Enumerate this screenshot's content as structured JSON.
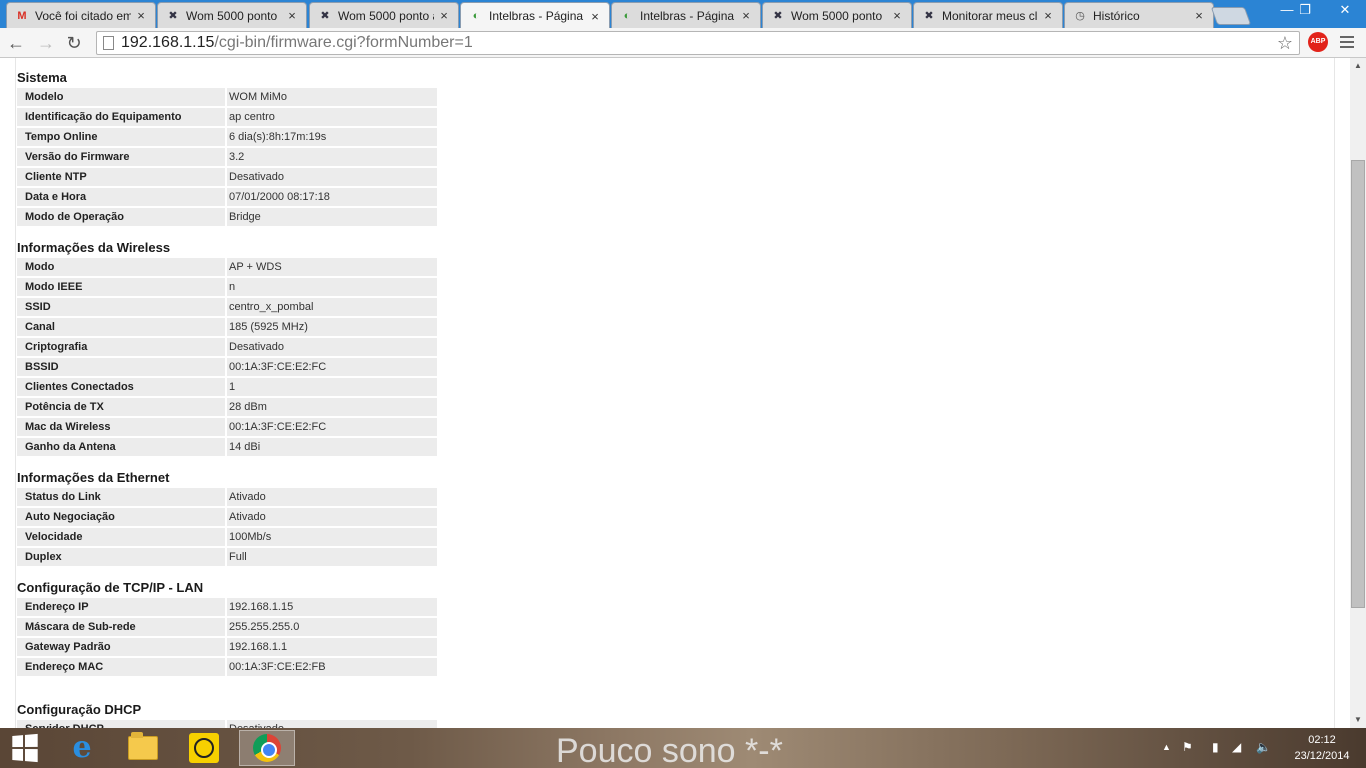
{
  "tabs": [
    {
      "title": "Você foi citado em",
      "icon": "gmail-icon",
      "active": false
    },
    {
      "title": "Wom 5000 ponto",
      "icon": "x-icon",
      "active": false
    },
    {
      "title": "Wom 5000 ponto a",
      "icon": "x-icon",
      "active": false
    },
    {
      "title": "Intelbras - Página",
      "icon": "intelbras-icon",
      "active": true
    },
    {
      "title": "Intelbras - Página",
      "icon": "intelbras-icon",
      "active": false
    },
    {
      "title": "Wom 5000 ponto",
      "icon": "x-icon",
      "active": false
    },
    {
      "title": "Monitorar meus cl",
      "icon": "x-icon",
      "active": false
    },
    {
      "title": "Histórico",
      "icon": "history-icon",
      "active": false
    }
  ],
  "toolbar": {
    "url_host": "192.168.1.15",
    "url_path": "/cgi-bin/firmware.cgi?formNumber=1",
    "abp_label": "ABP"
  },
  "sections": [
    {
      "heading": "Sistema",
      "rows": [
        {
          "label": "Modelo",
          "value": "WOM MiMo"
        },
        {
          "label": "Identificação do Equipamento",
          "value": "ap centro"
        },
        {
          "label": "Tempo Online",
          "value": "6 dia(s):8h:17m:19s"
        },
        {
          "label": "Versão do Firmware",
          "value": "3.2"
        },
        {
          "label": "Cliente NTP",
          "value": "Desativado"
        },
        {
          "label": "Data e Hora",
          "value": "07/01/2000 08:17:18"
        },
        {
          "label": "Modo de Operação",
          "value": "Bridge"
        }
      ]
    },
    {
      "heading": "Informações da Wireless",
      "rows": [
        {
          "label": "Modo",
          "value": "AP + WDS"
        },
        {
          "label": "Modo IEEE",
          "value": "n"
        },
        {
          "label": "SSID",
          "value": "centro_x_pombal"
        },
        {
          "label": "Canal",
          "value": "185 (5925 MHz)"
        },
        {
          "label": "Criptografia",
          "value": "Desativado"
        },
        {
          "label": "BSSID",
          "value": "00:1A:3F:CE:E2:FC"
        },
        {
          "label": "Clientes Conectados",
          "value": "1"
        },
        {
          "label": "Potência de TX",
          "value": "28 dBm"
        },
        {
          "label": "Mac da Wireless",
          "value": "00:1A:3F:CE:E2:FC"
        },
        {
          "label": "Ganho da Antena",
          "value": "14 dBi"
        }
      ]
    },
    {
      "heading": "Informações da Ethernet",
      "rows": [
        {
          "label": "Status do Link",
          "value": "Ativado"
        },
        {
          "label": "Auto Negociação",
          "value": "Ativado"
        },
        {
          "label": "Velocidade",
          "value": "100Mb/s"
        },
        {
          "label": "Duplex",
          "value": "Full"
        }
      ]
    },
    {
      "heading": "Configuração de TCP/IP - LAN",
      "rows": [
        {
          "label": "Endereço IP",
          "value": "192.168.1.15"
        },
        {
          "label": "Máscara de Sub-rede",
          "value": "255.255.255.0"
        },
        {
          "label": "Gateway Padrão",
          "value": "192.168.1.1"
        },
        {
          "label": "Endereço MAC",
          "value": "00:1A:3F:CE:E2:FB"
        }
      ]
    },
    {
      "heading": "Configuração DHCP",
      "rows": [
        {
          "label": "Servidor DHCP",
          "value": "Desativado"
        }
      ]
    }
  ],
  "taskbar": {
    "wallpaper_text": "Pouco sono *-*",
    "time": "02:12",
    "date": "23/12/2014"
  }
}
